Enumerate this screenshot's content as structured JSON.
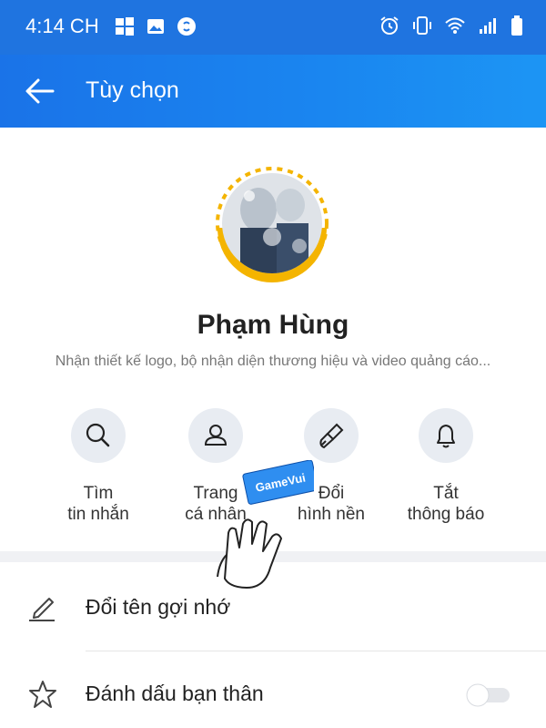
{
  "status_bar": {
    "time": "4:14 CH",
    "left_icons": [
      "windows-icon",
      "image-icon",
      "shazam-icon"
    ],
    "right_icons": [
      "alarm-icon",
      "vibrate-icon",
      "wifi-icon",
      "signal-icon",
      "battery-icon"
    ]
  },
  "header": {
    "title": "Tùy chọn",
    "back_icon": "arrow-left-icon",
    "background": "#1a73e8"
  },
  "profile": {
    "name": "Phạm Hùng",
    "bio": "Nhận thiết kế logo, bộ nhận diện thương hiệu và video quảng cáo..."
  },
  "actions": [
    {
      "icon": "search-icon",
      "line1": "Tìm",
      "line2": "tin nhắn"
    },
    {
      "icon": "person-icon",
      "line1": "Trang",
      "line2": "cá nhân"
    },
    {
      "icon": "brush-icon",
      "line1": "Đổi",
      "line2": "hình nền"
    },
    {
      "icon": "bell-icon",
      "line1": "Tắt",
      "line2": "thông báo"
    }
  ],
  "menu": [
    {
      "icon": "pencil-icon",
      "label": "Đổi tên gợi nhớ"
    },
    {
      "icon": "star-icon",
      "label": "Đánh dấu bạn thân",
      "toggle": false
    }
  ],
  "overlay": {
    "hand_card_text": "GameVui"
  }
}
